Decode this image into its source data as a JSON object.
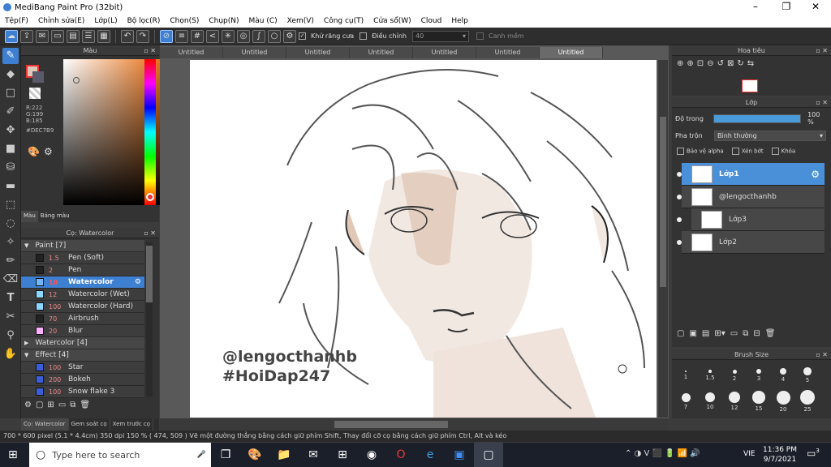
{
  "window": {
    "title": "MediBang Paint Pro (32bit)"
  },
  "menu": [
    "Tệp(F)",
    "Chỉnh sửa(E)",
    "Lớp(L)",
    "Bộ lọc(R)",
    "Chọn(S)",
    "Chụp(N)",
    "Màu (C)",
    "Xem(V)",
    "Công cụ(T)",
    "Cửa sổ(W)",
    "Cloud",
    "Help"
  ],
  "toolbar": {
    "antialias_label": "Khử răng cưa",
    "adjust_label": "Điều chỉnh",
    "adjust_value": "40",
    "smooth_label": "Canh mềm"
  },
  "color_panel": {
    "title": "Màu",
    "r": "R:222",
    "g": "G:199",
    "b": "B:185",
    "hex": "#DEC7B9",
    "tabs": [
      "Màu",
      "Bảng màu"
    ],
    "current_color": "#DEC7B9"
  },
  "brush_panel": {
    "title": "Cọ: Watercolor",
    "rows": [
      {
        "kind": "group",
        "label": "Paint [7]",
        "open": true
      },
      {
        "kind": "item",
        "size": "1.5",
        "name": "Pen (Soft)",
        "color": "#222222"
      },
      {
        "kind": "item",
        "size": "2",
        "name": "Pen",
        "color": "#222222"
      },
      {
        "kind": "item",
        "size": "10",
        "name": "Watercolor",
        "color": "#6fb7ff",
        "selected": true
      },
      {
        "kind": "item",
        "size": "12",
        "name": "Watercolor (Wet)",
        "color": "#8ad8ff"
      },
      {
        "kind": "item",
        "size": "100",
        "name": "Watercolor (Hard)",
        "color": "#8ad8ff"
      },
      {
        "kind": "item",
        "size": "70",
        "name": "Airbrush",
        "color": "#222222"
      },
      {
        "kind": "item",
        "size": "20",
        "name": "Blur",
        "color": "#ffb0ff"
      },
      {
        "kind": "group",
        "label": "Watercolor [4]",
        "open": false
      },
      {
        "kind": "group",
        "label": "Effect [4]",
        "open": true
      },
      {
        "kind": "item",
        "size": "100",
        "name": "Star",
        "color": "#3a5ed9"
      },
      {
        "kind": "item",
        "size": "200",
        "name": "Bokeh",
        "color": "#3a5ed9"
      },
      {
        "kind": "item",
        "size": "100",
        "name": "Snow flake 3",
        "color": "#3a5ed9"
      }
    ]
  },
  "left_bottom_tabs": [
    "Cọ: Watercolor",
    "Gem soát cọ",
    "Xem trước cọ"
  ],
  "doc_tabs": [
    "Untitled",
    "Untitled",
    "Untitled",
    "Untitled",
    "Untitled",
    "Untitled",
    "Untitled"
  ],
  "artwork": {
    "watermark_line1": "@lengocthanhb",
    "watermark_line2": "#HoiDap247"
  },
  "navigator": {
    "title": "Hoa tiêu"
  },
  "layer_panel": {
    "title": "Lớp",
    "opacity_label": "Độ trong",
    "opacity_value": "100 %",
    "opacity_fraction": 1.0,
    "blend_label": "Pha trộn",
    "blend_value": "Bình thường",
    "protect_alpha": "Bảo vệ alpha",
    "clipping": "Xén bớt",
    "lock": "Khóa",
    "layers": [
      {
        "name": "Lớp1",
        "selected": true
      },
      {
        "name": "@lengocthanhb",
        "selected": false
      },
      {
        "name": "Lớp3",
        "selected": false
      },
      {
        "name": "Lớp2",
        "selected": false
      }
    ]
  },
  "brush_size_panel": {
    "title": "Brush Size",
    "sizes": [
      "1",
      "1.5",
      "2",
      "3",
      "4",
      "5",
      "7",
      "10",
      "12",
      "15",
      "20",
      "25"
    ]
  },
  "status": {
    "text": "700 * 600 pixel   (5.1 * 4.4cm)   350 dpi   150 %   ( 474, 509 )   Vẽ một đường thẳng bằng cách giữ phím Shift, Thay đổi cỡ cọ bằng cách giữ phím Ctrl, Alt và kéo"
  },
  "taskbar": {
    "search_placeholder": "Type here to search",
    "time": "11:36 PM",
    "date": "9/7/2021",
    "lang": "VIE",
    "notif": "3"
  }
}
